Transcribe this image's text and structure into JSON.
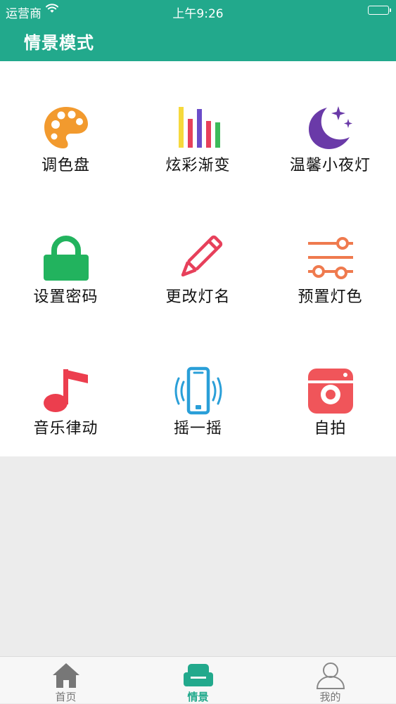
{
  "status_bar": {
    "carrier": "运营商",
    "time": "上午9:26"
  },
  "header": {
    "title": "情景模式"
  },
  "grid": {
    "items": [
      {
        "label": "调色盘",
        "icon": "palette-icon",
        "color": "#f29a2e"
      },
      {
        "label": "炫彩渐变",
        "icon": "color-bars-icon",
        "color": "#e7405b"
      },
      {
        "label": "温馨小夜灯",
        "icon": "moon-stars-icon",
        "color": "#6a3aa8"
      },
      {
        "label": "设置密码",
        "icon": "lock-icon",
        "color": "#22b35e"
      },
      {
        "label": "更改灯名",
        "icon": "pencil-icon",
        "color": "#e7405b"
      },
      {
        "label": "预置灯色",
        "icon": "sliders-icon",
        "color": "#ef7a4e"
      },
      {
        "label": "音乐律动",
        "icon": "music-note-icon",
        "color": "#ec3e4e"
      },
      {
        "label": "摇一摇",
        "icon": "phone-shake-icon",
        "color": "#2a9fd8"
      },
      {
        "label": "自拍",
        "icon": "camera-icon",
        "color": "#f0555a"
      }
    ]
  },
  "tabbar": {
    "tabs": [
      {
        "label": "首页",
        "icon": "home-icon",
        "active": false
      },
      {
        "label": "情景",
        "icon": "sofa-icon",
        "active": true
      },
      {
        "label": "我的",
        "icon": "user-icon",
        "active": false
      }
    ]
  },
  "colors": {
    "brand": "#22a98c",
    "tab_inactive": "#777777",
    "background": "#ececec"
  }
}
